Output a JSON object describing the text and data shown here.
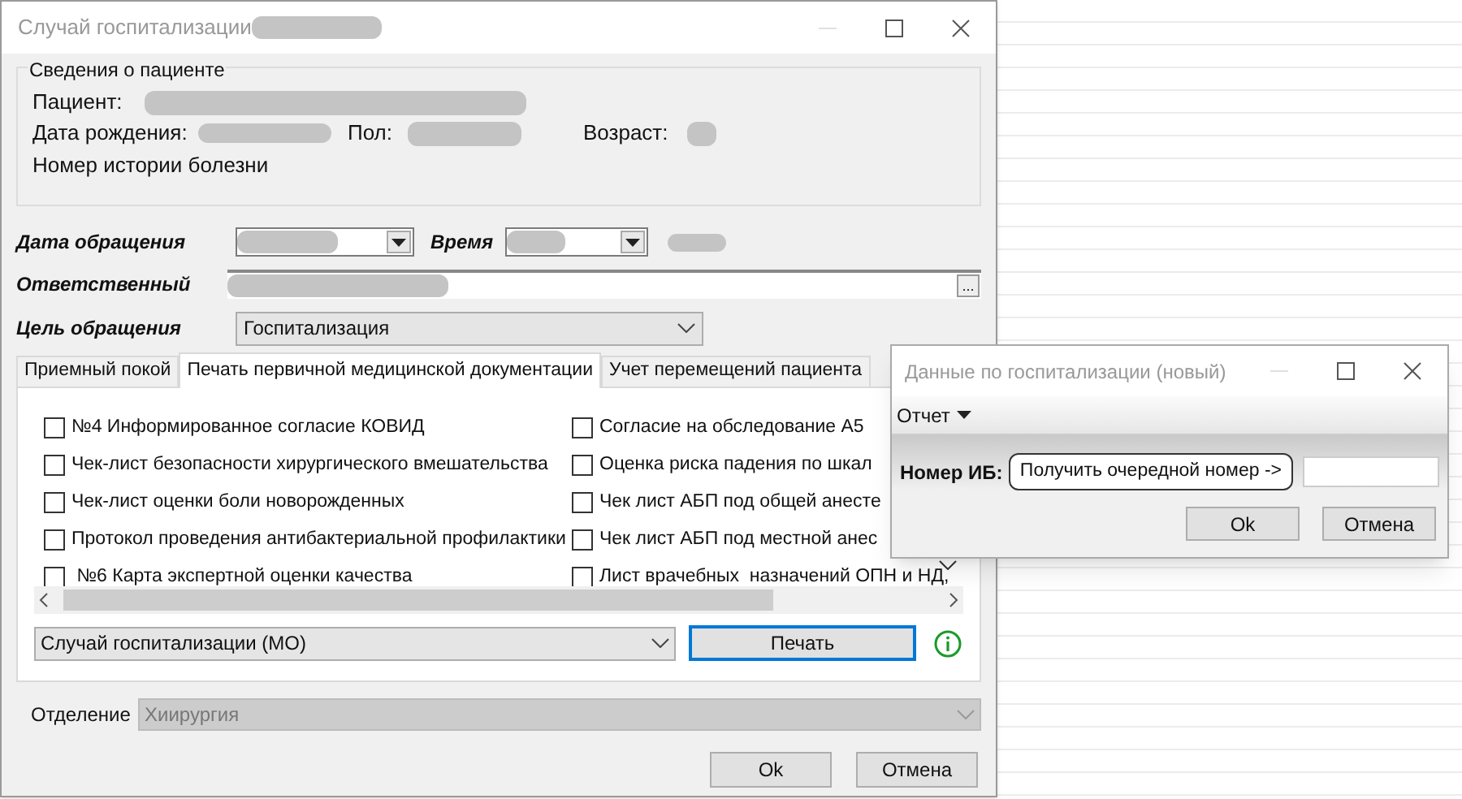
{
  "main_window": {
    "title": "Случай госпитализации",
    "patient_group": {
      "legend": "Сведения о пациенте",
      "patient_label": "Пациент:",
      "birth_label": "Дата рождения:",
      "sex_label": "Пол:",
      "age_label": "Возраст:",
      "history_label": "Номер истории болезни"
    },
    "form": {
      "date_label": "Дата обращения",
      "time_label": "Время",
      "responsible_label": "Ответственный",
      "browse_button": "...",
      "purpose_label": "Цель обращения",
      "purpose_value": "Госпитализация"
    },
    "tabs": [
      {
        "label": "Приемный покой",
        "selected": false
      },
      {
        "label": "Печать первичной медицинской документации",
        "selected": true
      },
      {
        "label": "Учет перемещений пациента",
        "selected": false
      }
    ],
    "documents": [
      {
        "label": "№4 Информированное согласие КОВИД",
        "checked": false
      },
      {
        "label": "Согласие на обследование А5",
        "checked": false
      },
      {
        "label": "Чек-лист безопасности хирургического вмешательства",
        "checked": false
      },
      {
        "label": "Оценка риска падения по шкал",
        "checked": false
      },
      {
        "label": "Чек-лист оценки боли новорожденных",
        "checked": false
      },
      {
        "label": "Чек лист АБП под общей анесте",
        "checked": false
      },
      {
        "label": "Протокол проведения антибактериальной профилактики",
        "checked": false
      },
      {
        "label": "Чек лист АБП под местной анес",
        "checked": false
      },
      {
        "label": " №6 Карта экспертной оценки качества",
        "checked": false
      },
      {
        "label": "Лист врачебных  назначений ОПН и НД,",
        "checked": false
      }
    ],
    "report_select": "Случай госпитализации (МО)",
    "print_button": "Печать",
    "department": {
      "label": "Отделение",
      "value": "Хиирургия",
      "disabled": true
    },
    "buttons": [
      "Ok",
      "Отмена"
    ]
  },
  "dialog": {
    "title": "Данные по госпитализации (новый)",
    "menu": "Отчет",
    "number_label": "Номер ИБ:",
    "get_number_button": "Получить очередной номер ->",
    "buttons": [
      "Ok",
      "Отмена"
    ]
  }
}
